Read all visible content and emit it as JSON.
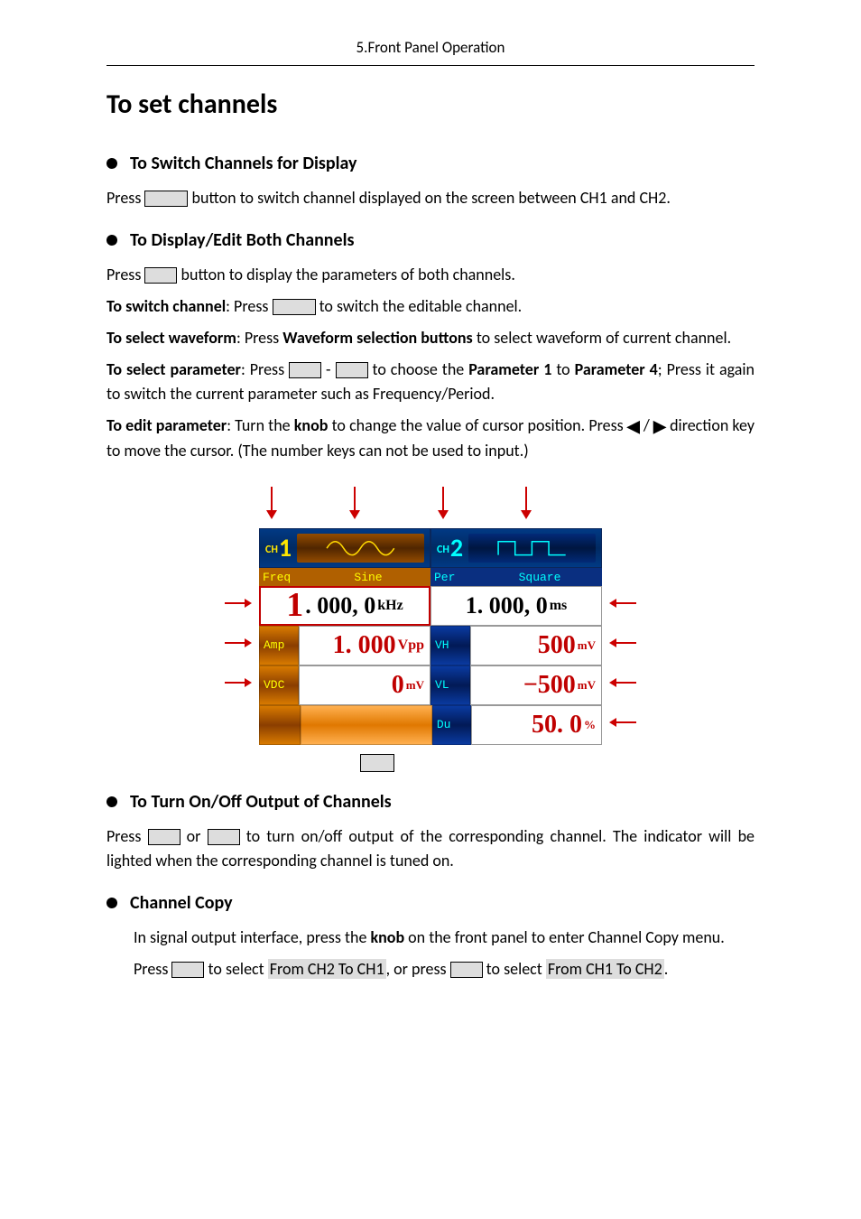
{
  "header": {
    "breadcrumb": "5.Front Panel Operation"
  },
  "title": "To set channels",
  "sections": {
    "switch": {
      "heading": "To Switch Channels for Display",
      "p1a": "Press ",
      "p1b": " button to switch channel displayed on the screen between CH1 and CH2."
    },
    "both": {
      "heading": "To Display/Edit Both Channels",
      "p1a": "Press ",
      "p1b": " button to display the parameters of both channels.",
      "p2a": "To switch channel",
      "p2b": ": Press ",
      "p2c": " to switch the editable channel.",
      "p3a": "To select waveform",
      "p3b": ": Press ",
      "p3c": "Waveform selection buttons",
      "p3d": " to select waveform of current channel.",
      "p4a": "To select parameter",
      "p4b": ": Press ",
      "p4c": " - ",
      "p4d": " to choose the ",
      "p4e": "Parameter 1",
      "p4f": " to ",
      "p4g": "Parameter 4",
      "p4h": "; Press it again to switch the current parameter such as Frequency/Period.",
      "p5a": "To edit parameter",
      "p5b": ": Turn the ",
      "p5c": "knob",
      "p5d": " to change the value of cursor position. Press ",
      "p5e": " / ",
      "p5f": " direction key to move the cursor. (The number keys can not be used to input.)"
    },
    "output": {
      "heading": "To Turn On/Off Output of Channels",
      "p1a": "Press ",
      "p1b": " or ",
      "p1c": " to turn on/off output of the corresponding channel. The indicator will be lighted when the corresponding channel is tuned on."
    },
    "copy": {
      "heading": "Channel Copy",
      "p1a": "In signal output interface, press the ",
      "p1b": "knob",
      "p1c": " on the front panel to enter Channel Copy menu.",
      "p2a": "Press ",
      "p2b": " to select ",
      "p2c": "From CH2 To CH1",
      "p2d": ", or press ",
      "p2e": " to select ",
      "p2f": "From CH1 To CH2",
      "p2g": "."
    }
  },
  "lcd": {
    "ch1": {
      "badge": "CH",
      "num": "1",
      "wave_name": "Sine",
      "freq_label": "Freq",
      "freq_digit1": "1",
      "freq_rest": ". 000, 0",
      "freq_unit": "kHz",
      "amp_label": "Amp",
      "amp_value": "1. 000",
      "amp_unit": "Vpp",
      "vdc_label": "VDC",
      "vdc_value": "0",
      "vdc_unit": "mV"
    },
    "ch2": {
      "badge": "CH",
      "num": "2",
      "wave_name": "Square",
      "per_label": "Per",
      "per_value": "1. 000, 0",
      "per_unit": "ms",
      "vh_label": "VH",
      "vh_value": "500",
      "vh_unit": "mV",
      "vl_label": "VL",
      "vl_value": "−500",
      "vl_unit": "mV",
      "du_label": "Du",
      "du_value": "50. 0",
      "du_unit": "%"
    }
  },
  "chart_data": {
    "type": "table",
    "title": "Dual-channel parameter display",
    "channels": [
      {
        "id": "CH1",
        "waveform": "Sine",
        "params": [
          {
            "name": "Freq",
            "value": 1.0,
            "unit": "kHz"
          },
          {
            "name": "Amp",
            "value": 1.0,
            "unit": "Vpp"
          },
          {
            "name": "VDC",
            "value": 0,
            "unit": "mV"
          }
        ]
      },
      {
        "id": "CH2",
        "waveform": "Square",
        "params": [
          {
            "name": "Per",
            "value": 1.0,
            "unit": "ms"
          },
          {
            "name": "VH",
            "value": 500,
            "unit": "mV"
          },
          {
            "name": "VL",
            "value": -500,
            "unit": "mV"
          },
          {
            "name": "Du",
            "value": 50.0,
            "unit": "%"
          }
        ]
      }
    ]
  }
}
